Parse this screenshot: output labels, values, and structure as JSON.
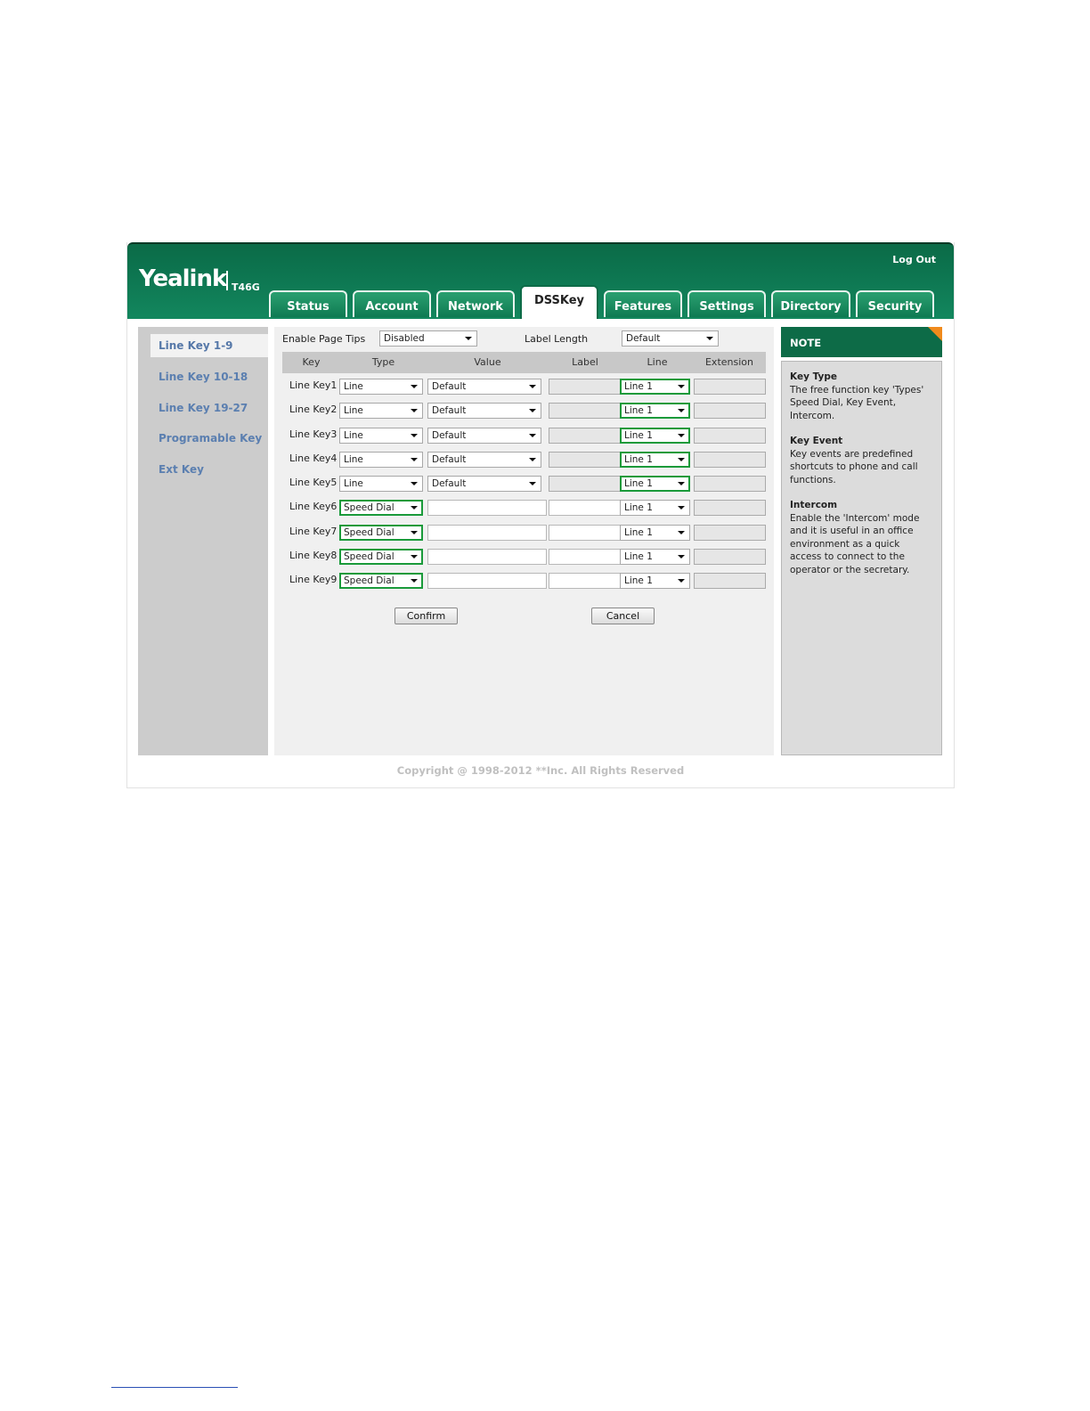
{
  "header": {
    "logo": "Yealink",
    "model": "T46G",
    "logout_label": "Log Out"
  },
  "tabs": [
    {
      "label": "Status"
    },
    {
      "label": "Account"
    },
    {
      "label": "Network"
    },
    {
      "label": "DSSKey",
      "active": true
    },
    {
      "label": "Features"
    },
    {
      "label": "Settings"
    },
    {
      "label": "Directory"
    },
    {
      "label": "Security"
    }
  ],
  "sidebar": {
    "items": [
      {
        "label": "Line Key 1-9",
        "active": true
      },
      {
        "label": "Line Key 10-18"
      },
      {
        "label": "Line Key 19-27"
      },
      {
        "label": "Programable Key"
      },
      {
        "label": "Ext Key"
      }
    ]
  },
  "settings": {
    "page_tips_label": "Enable Page Tips",
    "page_tips_value": "Disabled",
    "label_length_label": "Label Length",
    "label_length_value": "Default"
  },
  "table": {
    "headers": [
      "Key",
      "Type",
      "Value",
      "Label",
      "Line",
      "Extension"
    ],
    "rows": [
      {
        "key": "Line Key1",
        "type": "Line",
        "value": "Default",
        "line": "Line 1"
      },
      {
        "key": "Line Key2",
        "type": "Line",
        "value": "Default",
        "line": "Line 1"
      },
      {
        "key": "Line Key3",
        "type": "Line",
        "value": "Default",
        "line": "Line 1"
      },
      {
        "key": "Line Key4",
        "type": "Line",
        "value": "Default",
        "line": "Line 1"
      },
      {
        "key": "Line Key5",
        "type": "Line",
        "value": "Default",
        "line": "Line 1"
      },
      {
        "key": "Line Key6",
        "type": "Speed Dial",
        "value": "",
        "line": "Line 1"
      },
      {
        "key": "Line Key7",
        "type": "Speed Dial",
        "value": "",
        "line": "Line 1"
      },
      {
        "key": "Line Key8",
        "type": "Speed Dial",
        "value": "",
        "line": "Line 1"
      },
      {
        "key": "Line Key9",
        "type": "Speed Dial",
        "value": "",
        "line": "Line 1"
      }
    ]
  },
  "buttons": {
    "confirm": "Confirm",
    "cancel": "Cancel"
  },
  "note": {
    "title": "NOTE",
    "sections": [
      {
        "title": "Key Type",
        "text": "The free function key 'Types' Speed Dial, Key Event, Intercom."
      },
      {
        "title": "Key Event",
        "text": "Key events are predefined shortcuts to phone and call functions."
      },
      {
        "title": "Intercom",
        "text": "Enable the 'Intercom' mode and it is useful in an office environment as a quick access to connect to the operator or the secretary."
      }
    ]
  },
  "footer": {
    "copyright": "Copyright @ 1998-2012 **Inc. All Rights Reserved"
  },
  "colors": {
    "brand_green": "#0d6b47",
    "highlight_green": "#1a9a3a",
    "note_corner": "#f08a1c",
    "sidebar_link": "#5b7fb0"
  }
}
